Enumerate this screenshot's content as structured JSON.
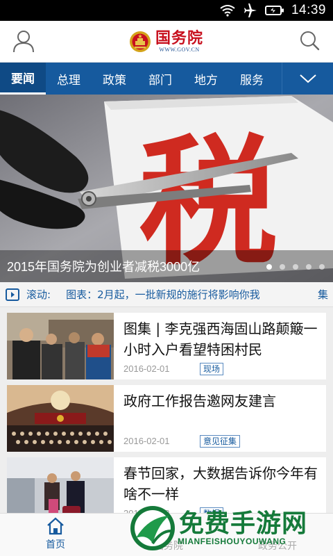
{
  "status_bar": {
    "time": "14:39",
    "icons": [
      "wifi-icon",
      "airplane-icon",
      "battery-icon"
    ]
  },
  "header": {
    "logo_title": "国务院",
    "logo_subtitle": "WWW.GOV.CN",
    "icons": [
      "user-icon",
      "search-icon"
    ]
  },
  "nav": {
    "tabs": [
      {
        "label": "要闻",
        "active": true
      },
      {
        "label": "总理"
      },
      {
        "label": "政策"
      },
      {
        "label": "部门"
      },
      {
        "label": "地方"
      },
      {
        "label": "服务"
      }
    ],
    "more_icon": "chevron-down-icon"
  },
  "hero": {
    "image_text": "税",
    "caption": "2015年国务院为创业者减税3000亿",
    "slide_count": 5,
    "active_slide": 1
  },
  "ticker": {
    "label": "滚动:",
    "text": "图表：2月起，一批新规的施行将影响你我",
    "next_text": "集"
  },
  "feed": [
    {
      "title": "图集 | 李克强西海固山路颠簸一小时入户看望特困村民",
      "date": "2016-02-01",
      "tag": "现场"
    },
    {
      "title": "政府工作报告邀网友建言",
      "date": "2016-02-01",
      "tag": "意见征集"
    },
    {
      "title": "春节回家，大数据告诉你今年有啥不一样",
      "date": "2016-02-02",
      "tag": "数据"
    }
  ],
  "tabbar": {
    "home_label": "首页",
    "mid_label": "国务院",
    "right_label": "政务公开"
  },
  "watermark": {
    "text": "免费手游网",
    "sub": "MIANFEISHOUYOUWANG"
  },
  "colors": {
    "brand_blue": "#165a9e",
    "brand_red": "#c8101e",
    "watermark_green": "#157a3a"
  }
}
